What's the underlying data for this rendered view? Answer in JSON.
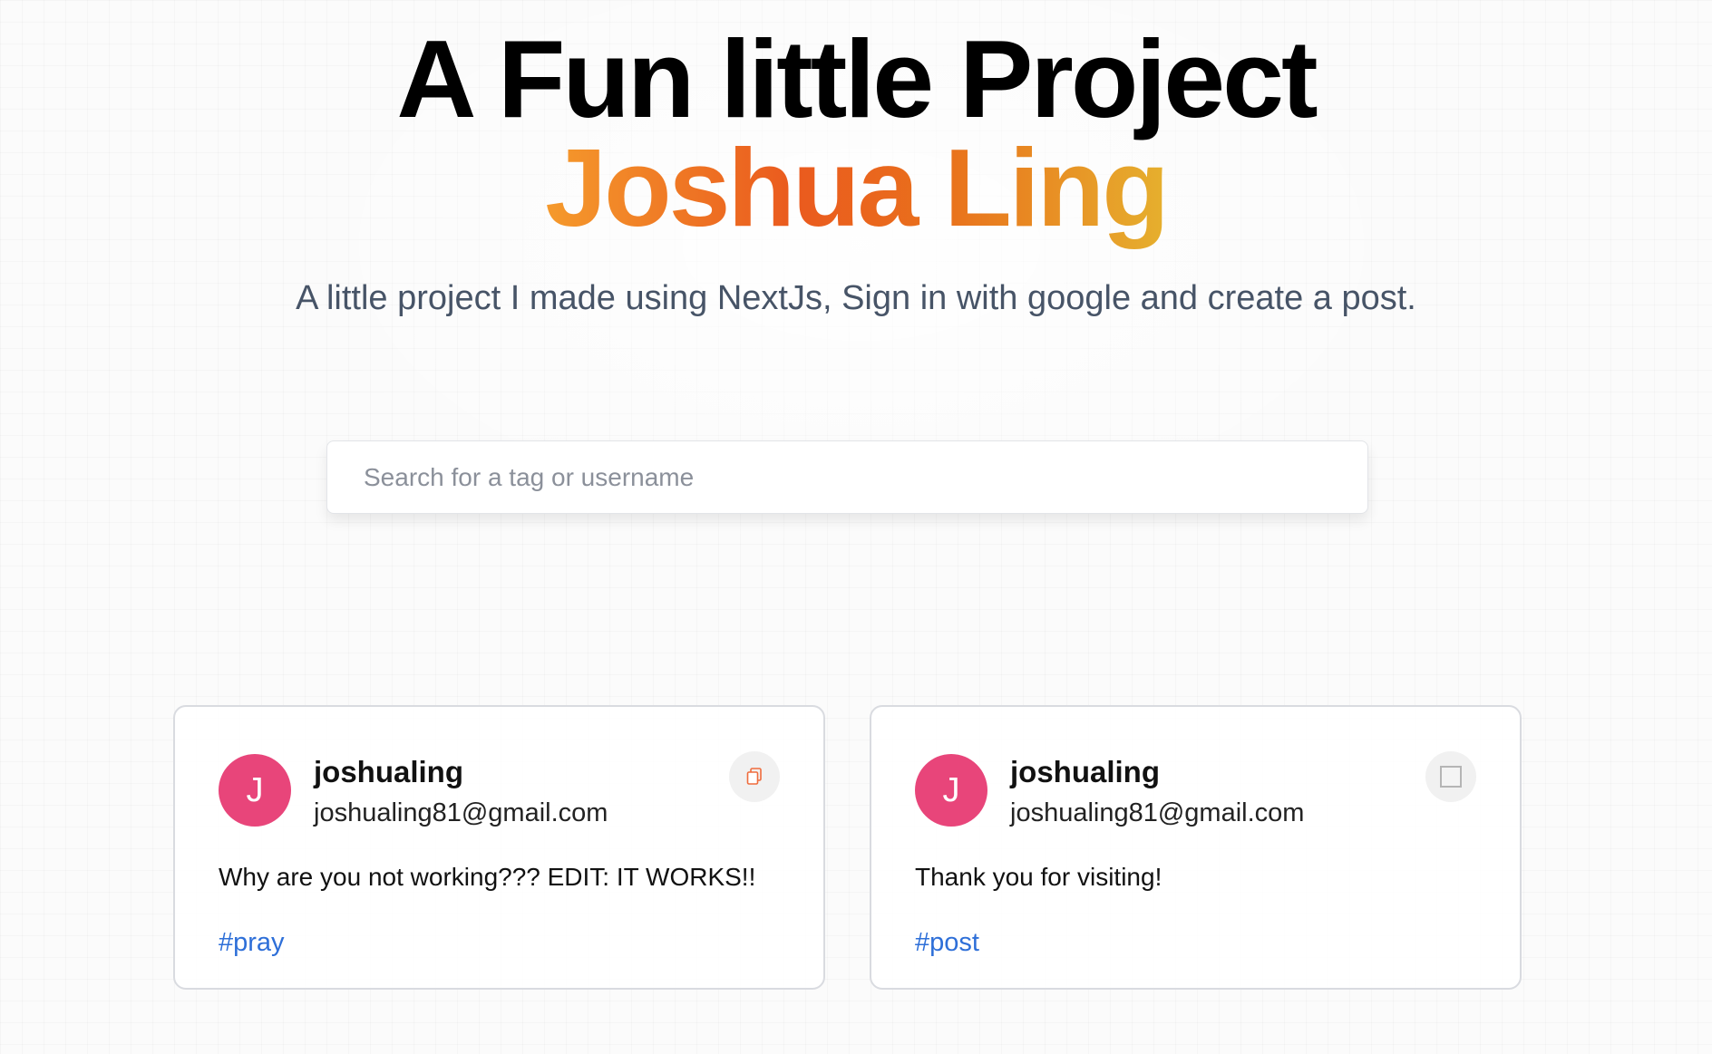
{
  "hero": {
    "title_line1": "A Fun little Project",
    "title_line2": "Joshua Ling",
    "subtitle": "A little project I made using NextJs, Sign in with google and create a post."
  },
  "search": {
    "placeholder": "Search for a tag or username",
    "value": ""
  },
  "posts": [
    {
      "avatar_letter": "J",
      "avatar_color": "#e8457a",
      "username": "joshualing",
      "email": "joshualing81@gmail.com",
      "content": "Why are you not working??? EDIT: IT WORKS!!",
      "tag": "#pray",
      "action_icon": "copy-icon"
    },
    {
      "avatar_letter": "J",
      "avatar_color": "#e8457a",
      "username": "joshualing",
      "email": "joshualing81@gmail.com",
      "content": "Thank you for visiting!",
      "tag": "#post",
      "action_icon": "broken-image-icon"
    }
  ],
  "colors": {
    "gradient_start": "#f59a2c",
    "gradient_mid": "#ea5a1e",
    "gradient_end": "#e6b02e",
    "tag_link": "#2e6fd8"
  }
}
